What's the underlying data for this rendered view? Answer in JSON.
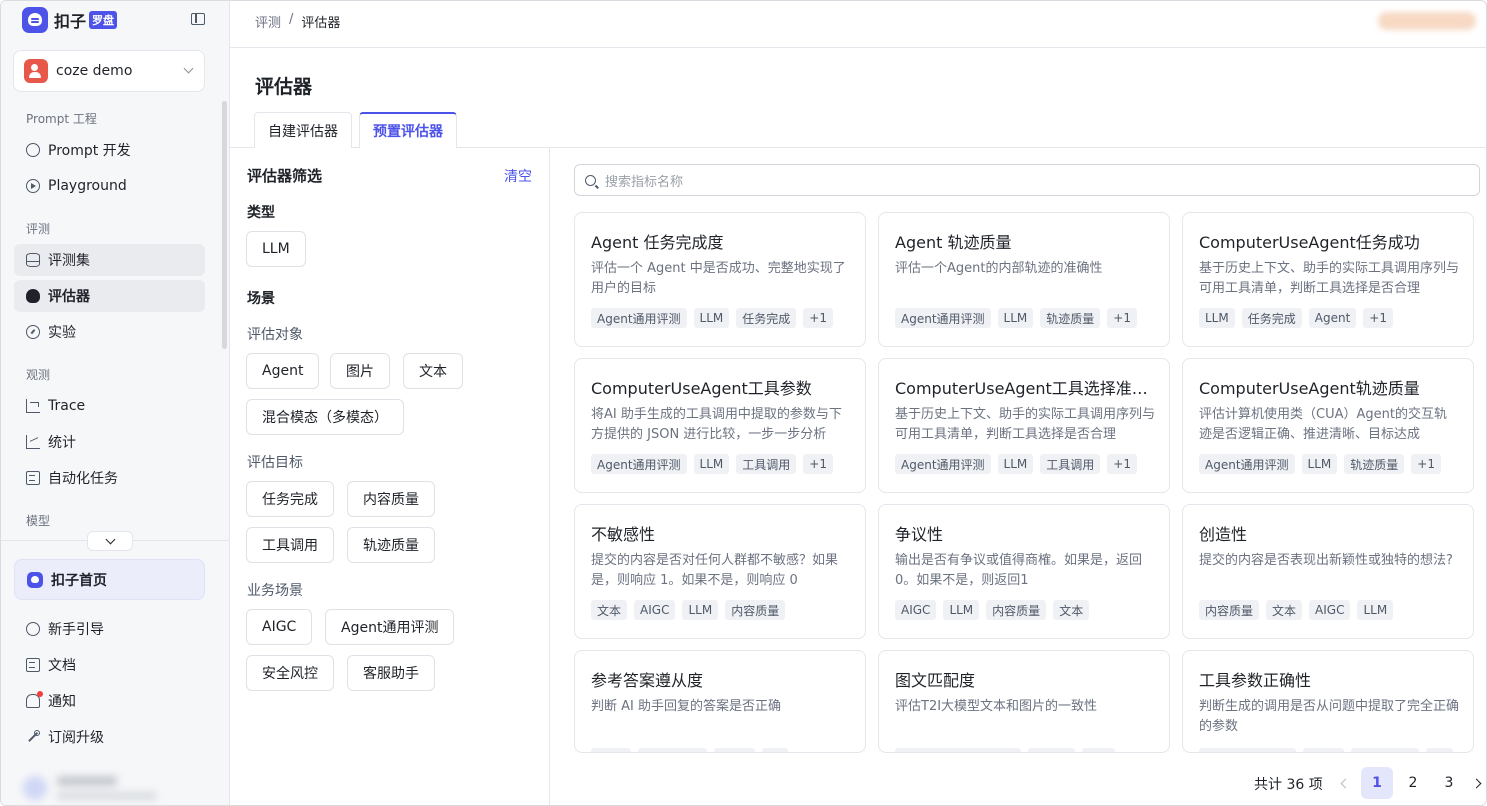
{
  "brand": {
    "name": "扣子",
    "badge": "罗盘"
  },
  "workspace": {
    "name": "coze demo"
  },
  "nav": {
    "groups": {
      "prompt": "Prompt 工程",
      "eval": "评测",
      "observe": "观测",
      "model": "模型"
    },
    "items": {
      "prompt_dev": "Prompt 开发",
      "playground": "Playground",
      "dataset": "评测集",
      "evaluator": "评估器",
      "experiment": "实验",
      "trace": "Trace",
      "stats": "统计",
      "auto_task": "自动化任务"
    },
    "home": "扣子首页",
    "footer": {
      "guide": "新手引导",
      "docs": "文档",
      "notify": "通知",
      "upgrade": "订阅升级"
    }
  },
  "breadcrumb": {
    "root": "评测",
    "sep": "/",
    "current": "评估器"
  },
  "page": {
    "title": "评估器",
    "tabs": [
      "自建评估器",
      "预置评估器"
    ]
  },
  "filter": {
    "title": "评估器筛选",
    "clear": "清空",
    "type_label": "类型",
    "type_chips": [
      "LLM"
    ],
    "scene_label": "场景",
    "target_label": "评估对象",
    "target_chips": [
      "Agent",
      "图片",
      "文本",
      "混合模态（多模态）"
    ],
    "goal_label": "评估目标",
    "goal_chips": [
      "任务完成",
      "内容质量",
      "工具调用",
      "轨迹质量"
    ],
    "biz_label": "业务场景",
    "biz_chips": [
      "AIGC",
      "Agent通用评测",
      "安全风控",
      "客服助手"
    ]
  },
  "search": {
    "placeholder": "搜索指标名称"
  },
  "cards": [
    {
      "title": "Agent 任务完成度",
      "desc": "评估一个 Agent 中是否成功、完整地实现了用户的目标",
      "tags": [
        "Agent通用评测",
        "LLM",
        "任务完成",
        "+1"
      ]
    },
    {
      "title": "Agent 轨迹质量",
      "desc": "评估一个Agent的内部轨迹的准确性",
      "tags": [
        "Agent通用评测",
        "LLM",
        "轨迹质量",
        "+1"
      ]
    },
    {
      "title": "ComputerUseAgent任务成功",
      "desc": "基于历史上下文、助手的实际工具调用序列与可用工具清单，判断工具选择是否合理",
      "tags": [
        "LLM",
        "任务完成",
        "Agent",
        "+1"
      ]
    },
    {
      "title": "ComputerUseAgent工具参数",
      "desc": "将AI 助手生成的工具调用中提取的参数与下方提供的 JSON 进行比较，一步一步分析",
      "tags": [
        "Agent通用评测",
        "LLM",
        "工具调用",
        "+1"
      ]
    },
    {
      "title": "ComputerUseAgent工具选择准确性",
      "desc": "基于历史上下文、助手的实际工具调用序列与可用工具清单，判断工具选择是否合理",
      "tags": [
        "Agent通用评测",
        "LLM",
        "工具调用",
        "+1"
      ]
    },
    {
      "title": "ComputerUseAgent轨迹质量",
      "desc": "评估计算机使用类（CUA）Agent的交互轨迹是否逻辑正确、推进清晰、目标达成",
      "tags": [
        "Agent通用评测",
        "LLM",
        "轨迹质量",
        "+1"
      ]
    },
    {
      "title": "不敏感性",
      "desc": "提交的内容是否对任何人群都不敏感？如果是，则响应 1。如果不是，则响应 0",
      "tags": [
        "文本",
        "AIGC",
        "LLM",
        "内容质量"
      ]
    },
    {
      "title": "争议性",
      "desc": "输出是否有争议或值得商榷。如果是，返回0。如果不是，则返回1",
      "tags": [
        "AIGC",
        "LLM",
        "内容质量",
        "文本"
      ]
    },
    {
      "title": "创造性",
      "desc": "提交的内容是否表现出新颖性或独特的想法?",
      "tags": [
        "内容质量",
        "文本",
        "AIGC",
        "LLM"
      ]
    },
    {
      "title": "参考答案遵从度",
      "desc": "判断 AI 助手回复的答案是否正确",
      "tags": [
        "xxxx",
        "xxxxxxxx",
        "xxxx",
        "xx"
      ]
    },
    {
      "title": "图文匹配度",
      "desc": "评估T2I大模型文本和图片的一致性",
      "tags": [
        "xxxxxxxxxxxxxxxx",
        "xxxxx",
        "xxx"
      ]
    },
    {
      "title": "工具参数正确性",
      "desc": "判断生成的调用是否从问题中提取了完全正确的参数",
      "tags": [
        "xxxxxxxxxxxx",
        "xxxx",
        "xxxxxxxx",
        "xx"
      ]
    }
  ],
  "pager": {
    "total": "共计 36 项",
    "pages": [
      "1",
      "2",
      "3"
    ]
  }
}
